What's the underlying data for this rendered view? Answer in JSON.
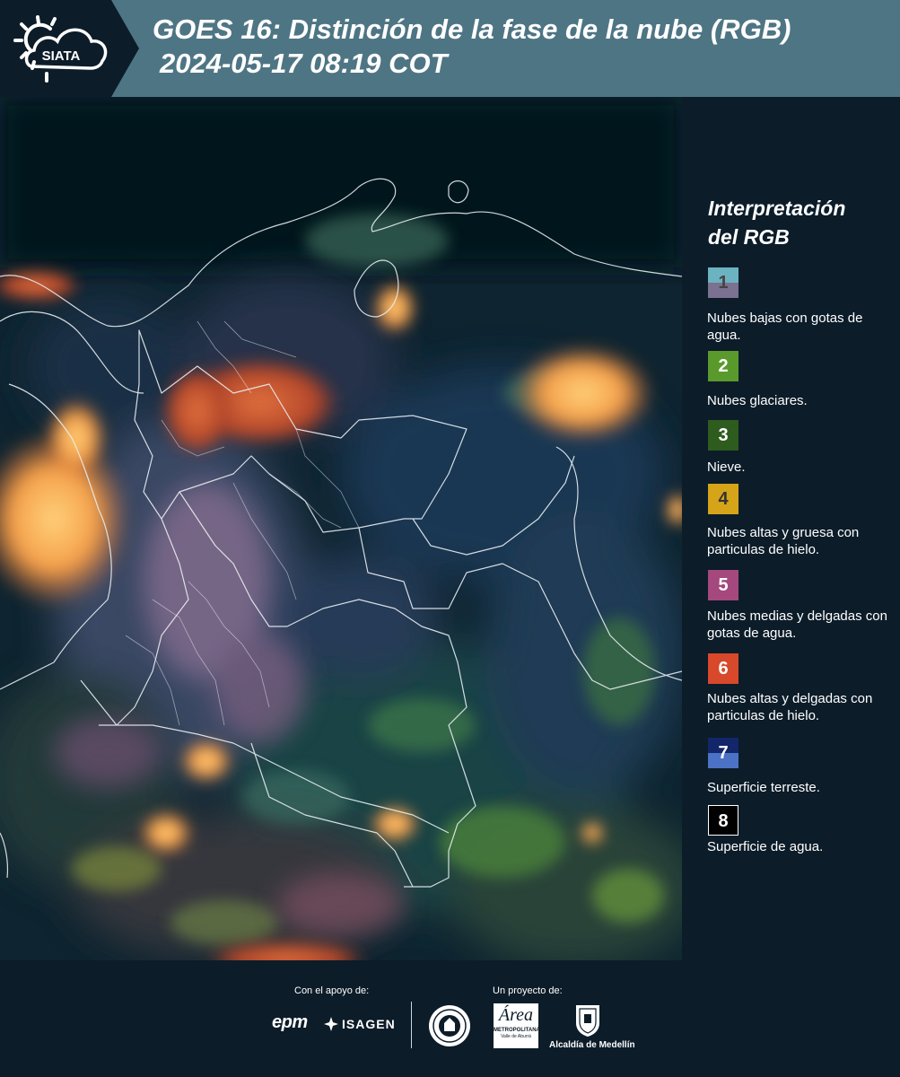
{
  "header": {
    "logo_text": "SIATA",
    "title_line1": "GOES 16: Distinción de la fase de la nube (RGB)",
    "title_line2": "2024-05-17 08:19 COT"
  },
  "legend": {
    "title_line1": "Interpretación",
    "title_line2": "del RGB",
    "items": [
      {
        "number": "1",
        "label": "Nubes bajas con gotas de agua.",
        "color_top": "#6cb3c2",
        "color_bottom": "#7b7190",
        "text_color": "#444444"
      },
      {
        "number": "2",
        "label": "Nubes glaciares.",
        "color_top": "#5a9a2d",
        "color_bottom": "#5a9a2d",
        "text_color": "#ffffff"
      },
      {
        "number": "3",
        "label": "Nieve.",
        "color_top": "#2e5b1e",
        "color_bottom": "#2e5b1e",
        "text_color": "#ffffff"
      },
      {
        "number": "4",
        "label": "Nubes altas y gruesa con particulas de hielo.",
        "color_top": "#d6a418",
        "color_bottom": "#d6a418",
        "text_color": "#333333"
      },
      {
        "number": "5",
        "label": "Nubes medias y delgadas con gotas de agua.",
        "color_top": "#a4487e",
        "color_bottom": "#a4487e",
        "text_color": "#ffffff"
      },
      {
        "number": "6",
        "label": "Nubes altas y delgadas con particulas de hielo.",
        "color_top": "#d8482a",
        "color_bottom": "#d8482a",
        "text_color": "#ffffff"
      },
      {
        "number": "7",
        "label": "Superficie terreste.",
        "color_top": "#13266a",
        "color_bottom": "#4b72c4",
        "text_color": "#ffffff"
      },
      {
        "number": "8",
        "label": "Superficie de agua.",
        "color_top": "#000000",
        "color_bottom": "#000000",
        "text_color": "#ffffff"
      }
    ]
  },
  "footer": {
    "support_label": "Con el apoyo de:",
    "project_label": "Un proyecto de:",
    "logo_epm": "epm",
    "logo_isagen": "ISAGEN",
    "logo_area_main": "Área",
    "logo_area_sub1": "METROPOLITANA",
    "logo_area_sub2": "Valle de Aburrá",
    "logo_alcaldia": "Alcaldía de Medellín"
  }
}
